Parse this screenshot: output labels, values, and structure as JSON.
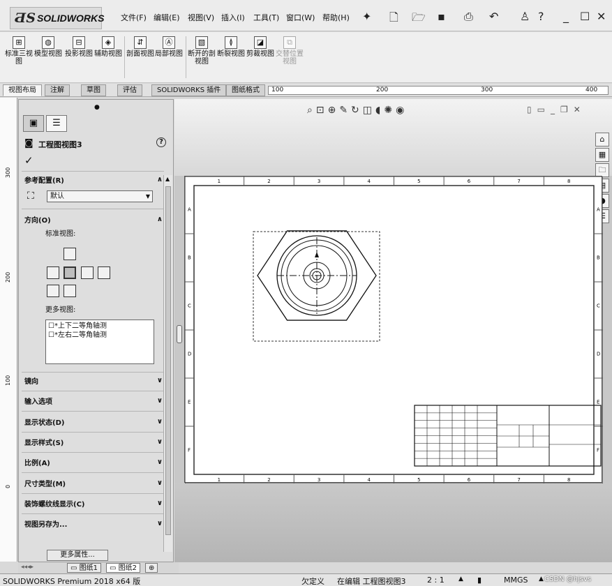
{
  "app": {
    "logo_prefix": "ƋS",
    "logo_text": "SOLIDWORKS"
  },
  "menu": [
    "文件(F)",
    "编辑(E)",
    "视图(V)",
    "插入(I)",
    "工具(T)",
    "窗口(W)",
    "帮助(H)"
  ],
  "ribbon": [
    {
      "label": "标准三视图",
      "icon": "standard-3-view-icon"
    },
    {
      "label": "模型视图",
      "icon": "model-view-icon"
    },
    {
      "label": "投影视图",
      "icon": "projected-view-icon"
    },
    {
      "label": "辅助视图",
      "icon": "auxiliary-view-icon"
    },
    {
      "label": "剖面视图",
      "icon": "section-view-icon"
    },
    {
      "label": "局部视图",
      "icon": "detail-view-icon"
    },
    {
      "label": "断开的剖视图",
      "icon": "broken-out-section-icon"
    },
    {
      "label": "断裂视图",
      "icon": "break-view-icon"
    },
    {
      "label": "剪裁视图",
      "icon": "crop-view-icon"
    },
    {
      "label": "交替位置视图",
      "icon": "alternate-position-view-icon",
      "disabled": true
    }
  ],
  "tabs": [
    "视图布局",
    "注解",
    "草图",
    "评估",
    "SOLIDWORKS 插件",
    "图纸格式"
  ],
  "hruler": [
    "100",
    "200",
    "300",
    "400"
  ],
  "vruler": [
    "300",
    "200",
    "100",
    "0"
  ],
  "property_manager": {
    "title": "工程图视图3",
    "help": "?",
    "ok": "✓",
    "reference_config": {
      "header": "参考配置(R)",
      "value": "默认"
    },
    "orientation": {
      "header": "方向(O)",
      "standard_views_label": "标准视图:",
      "more_views_label": "更多视图:",
      "more_views": [
        "*上下二等角轴测",
        "*左右二等角轴测"
      ]
    },
    "collapsed_groups": [
      "镜向",
      "输入选项",
      "显示状态(D)",
      "显示样式(S)",
      "比例(A)",
      "尺寸类型(M)",
      "装饰螺纹线显示(C)",
      "视图另存为..."
    ],
    "more_props_button": "更多属性..."
  },
  "drawing": {
    "border_cols": [
      "1",
      "2",
      "3",
      "4",
      "5",
      "6",
      "7",
      "8"
    ],
    "border_rows": [
      "A",
      "B",
      "C",
      "D",
      "E",
      "F"
    ]
  },
  "sheet_tabs": [
    "图纸1",
    "图纸2"
  ],
  "status": {
    "product": "SOLIDWORKS Premium 2018 x64 版",
    "state": "欠定义",
    "editing": "在编辑 工程图视图3",
    "scale": "2 : 1",
    "units": "MMGS",
    "watermark": "CSDN @hjsvs"
  }
}
